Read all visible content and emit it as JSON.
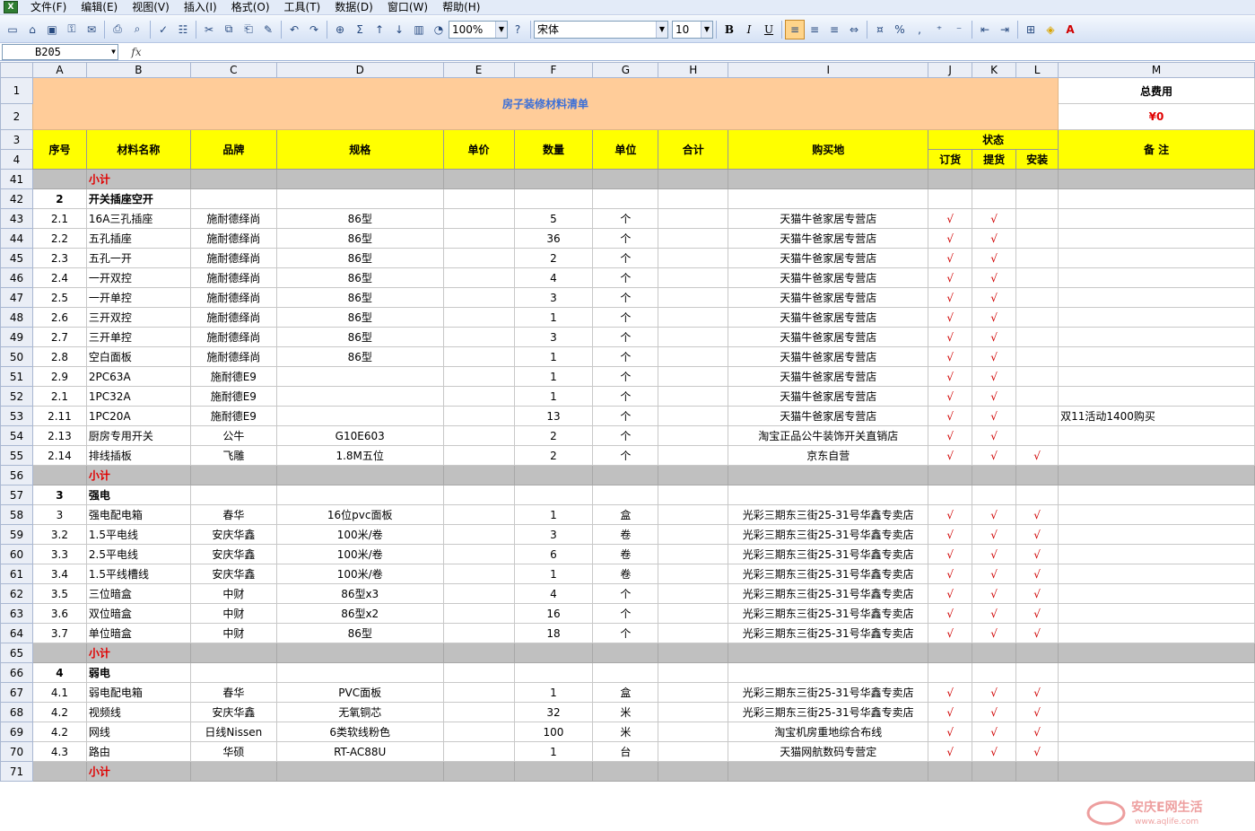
{
  "menubar": {
    "items": [
      "文件(F)",
      "编辑(E)",
      "视图(V)",
      "插入(I)",
      "格式(O)",
      "工具(T)",
      "数据(D)",
      "窗口(W)",
      "帮助(H)"
    ]
  },
  "toolbar": {
    "zoom": "100%",
    "font": "宋体",
    "font_size": "10"
  },
  "formula_bar": {
    "name_box": "B205",
    "fx": "fx",
    "content": ""
  },
  "columns": [
    "A",
    "B",
    "C",
    "D",
    "E",
    "F",
    "G",
    "H",
    "I",
    "J",
    "K",
    "L",
    "M"
  ],
  "sheet": {
    "title": "房子装修材料清单",
    "total_label": "总费用",
    "total_value": "¥0",
    "headers": {
      "seq": "序号",
      "name": "材料名称",
      "brand": "品牌",
      "spec": "规格",
      "price": "单价",
      "qty": "数量",
      "unit": "单位",
      "sum": "合计",
      "place": "购买地",
      "status": "状态",
      "order": "订货",
      "pickup": "提货",
      "install": "安装",
      "note": "备 注"
    },
    "rows": [
      {
        "r": "41",
        "type": "subtotal",
        "label": "小计"
      },
      {
        "r": "42",
        "type": "section",
        "seq": "2",
        "name": "开关插座空开"
      },
      {
        "r": "43",
        "seq": "2.1",
        "name": "16A三孔插座",
        "brand": "施耐德绎尚",
        "spec": "86型",
        "qty": "5",
        "unit": "个",
        "place": "天猫牛爸家居专营店",
        "j": "√",
        "k": "√",
        "l": "",
        "note": ""
      },
      {
        "r": "44",
        "seq": "2.2",
        "name": "五孔插座",
        "brand": "施耐德绎尚",
        "spec": "86型",
        "qty": "36",
        "unit": "个",
        "place": "天猫牛爸家居专营店",
        "j": "√",
        "k": "√",
        "l": "",
        "note": ""
      },
      {
        "r": "45",
        "seq": "2.3",
        "name": "五孔一开",
        "brand": "施耐德绎尚",
        "spec": "86型",
        "qty": "2",
        "unit": "个",
        "place": "天猫牛爸家居专营店",
        "j": "√",
        "k": "√",
        "l": "",
        "note": ""
      },
      {
        "r": "46",
        "seq": "2.4",
        "name": "一开双控",
        "brand": "施耐德绎尚",
        "spec": "86型",
        "qty": "4",
        "unit": "个",
        "place": "天猫牛爸家居专营店",
        "j": "√",
        "k": "√",
        "l": "",
        "note": ""
      },
      {
        "r": "47",
        "seq": "2.5",
        "name": "一开单控",
        "brand": "施耐德绎尚",
        "spec": "86型",
        "qty": "3",
        "unit": "个",
        "place": "天猫牛爸家居专营店",
        "j": "√",
        "k": "√",
        "l": "",
        "note": ""
      },
      {
        "r": "48",
        "seq": "2.6",
        "name": "三开双控",
        "brand": "施耐德绎尚",
        "spec": "86型",
        "qty": "1",
        "unit": "个",
        "place": "天猫牛爸家居专营店",
        "j": "√",
        "k": "√",
        "l": "",
        "note": ""
      },
      {
        "r": "49",
        "seq": "2.7",
        "name": "三开单控",
        "brand": "施耐德绎尚",
        "spec": "86型",
        "qty": "3",
        "unit": "个",
        "place": "天猫牛爸家居专营店",
        "j": "√",
        "k": "√",
        "l": "",
        "note": ""
      },
      {
        "r": "50",
        "seq": "2.8",
        "name": "空白面板",
        "brand": "施耐德绎尚",
        "spec": "86型",
        "qty": "1",
        "unit": "个",
        "place": "天猫牛爸家居专营店",
        "j": "√",
        "k": "√",
        "l": "",
        "note": ""
      },
      {
        "r": "51",
        "seq": "2.9",
        "name": "2PC63A",
        "brand": "施耐德E9",
        "spec": "",
        "qty": "1",
        "unit": "个",
        "place": "天猫牛爸家居专营店",
        "j": "√",
        "k": "√",
        "l": "",
        "note": ""
      },
      {
        "r": "52",
        "seq": "2.1",
        "name": "1PC32A",
        "brand": "施耐德E9",
        "spec": "",
        "qty": "1",
        "unit": "个",
        "place": "天猫牛爸家居专营店",
        "j": "√",
        "k": "√",
        "l": "",
        "note": ""
      },
      {
        "r": "53",
        "seq": "2.11",
        "name": "1PC20A",
        "brand": "施耐德E9",
        "spec": "",
        "qty": "13",
        "unit": "个",
        "place": "天猫牛爸家居专营店",
        "j": "√",
        "k": "√",
        "l": "",
        "note": "双11活动1400购买"
      },
      {
        "r": "54",
        "seq": "2.13",
        "name": "厨房专用开关",
        "brand": "公牛",
        "spec": "G10E603",
        "qty": "2",
        "unit": "个",
        "place": "淘宝正品公牛装饰开关直销店",
        "j": "√",
        "k": "√",
        "l": "",
        "note": ""
      },
      {
        "r": "55",
        "seq": "2.14",
        "name": "排线插板",
        "brand": "飞雕",
        "spec": "1.8M五位",
        "qty": "2",
        "unit": "个",
        "place": "京东自营",
        "j": "√",
        "k": "√",
        "l": "√",
        "note": ""
      },
      {
        "r": "56",
        "type": "subtotal",
        "label": "小计"
      },
      {
        "r": "57",
        "type": "section",
        "seq": "3",
        "name": "强电"
      },
      {
        "r": "58",
        "seq": "3",
        "name": "强电配电箱",
        "brand": "春华",
        "spec": "16位pvc面板",
        "qty": "1",
        "unit": "盒",
        "place": "光彩三期东三街25-31号华鑫专卖店",
        "j": "√",
        "k": "√",
        "l": "√",
        "note": ""
      },
      {
        "r": "59",
        "seq": "3.2",
        "name": "1.5平电线",
        "brand": "安庆华鑫",
        "spec": "100米/卷",
        "qty": "3",
        "unit": "卷",
        "place": "光彩三期东三街25-31号华鑫专卖店",
        "j": "√",
        "k": "√",
        "l": "√",
        "note": ""
      },
      {
        "r": "60",
        "seq": "3.3",
        "name": "2.5平电线",
        "brand": "安庆华鑫",
        "spec": "100米/卷",
        "qty": "6",
        "unit": "卷",
        "place": "光彩三期东三街25-31号华鑫专卖店",
        "j": "√",
        "k": "√",
        "l": "√",
        "note": ""
      },
      {
        "r": "61",
        "seq": "3.4",
        "name": "1.5平线槽线",
        "brand": "安庆华鑫",
        "spec": "100米/卷",
        "qty": "1",
        "unit": "卷",
        "place": "光彩三期东三街25-31号华鑫专卖店",
        "j": "√",
        "k": "√",
        "l": "√",
        "note": ""
      },
      {
        "r": "62",
        "seq": "3.5",
        "name": "三位暗盒",
        "brand": "中财",
        "spec": "86型x3",
        "qty": "4",
        "unit": "个",
        "place": "光彩三期东三街25-31号华鑫专卖店",
        "j": "√",
        "k": "√",
        "l": "√",
        "note": ""
      },
      {
        "r": "63",
        "seq": "3.6",
        "name": "双位暗盒",
        "brand": "中财",
        "spec": "86型x2",
        "qty": "16",
        "unit": "个",
        "place": "光彩三期东三街25-31号华鑫专卖店",
        "j": "√",
        "k": "√",
        "l": "√",
        "note": ""
      },
      {
        "r": "64",
        "seq": "3.7",
        "name": "单位暗盒",
        "brand": "中财",
        "spec": "86型",
        "qty": "18",
        "unit": "个",
        "place": "光彩三期东三街25-31号华鑫专卖店",
        "j": "√",
        "k": "√",
        "l": "√",
        "note": ""
      },
      {
        "r": "65",
        "type": "subtotal",
        "label": "小计"
      },
      {
        "r": "66",
        "type": "section",
        "seq": "4",
        "name": "弱电"
      },
      {
        "r": "67",
        "seq": "4.1",
        "name": "弱电配电箱",
        "brand": "春华",
        "spec": "PVC面板",
        "qty": "1",
        "unit": "盒",
        "place": "光彩三期东三街25-31号华鑫专卖店",
        "j": "√",
        "k": "√",
        "l": "√",
        "note": ""
      },
      {
        "r": "68",
        "seq": "4.2",
        "name": "视频线",
        "brand": "安庆华鑫",
        "spec": "无氧铜芯",
        "qty": "32",
        "unit": "米",
        "place": "光彩三期东三街25-31号华鑫专卖店",
        "j": "√",
        "k": "√",
        "l": "√",
        "note": ""
      },
      {
        "r": "69",
        "seq": "4.2",
        "name": "网线",
        "brand": "日线Nissen",
        "spec": "6类软线粉色",
        "qty": "100",
        "unit": "米",
        "place": "淘宝机房重地综合布线",
        "j": "√",
        "k": "√",
        "l": "√",
        "note": ""
      },
      {
        "r": "70",
        "seq": "4.3",
        "name": "路由",
        "brand": "华硕",
        "spec": "RT-AC88U",
        "qty": "1",
        "unit": "台",
        "place": "天猫网航数码专营定",
        "j": "√",
        "k": "√",
        "l": "√",
        "note": ""
      },
      {
        "r": "71",
        "type": "subtotal",
        "label": "小计"
      }
    ]
  },
  "watermark": {
    "text": "安庆E网生活",
    "url": "www.aqlife.com"
  }
}
